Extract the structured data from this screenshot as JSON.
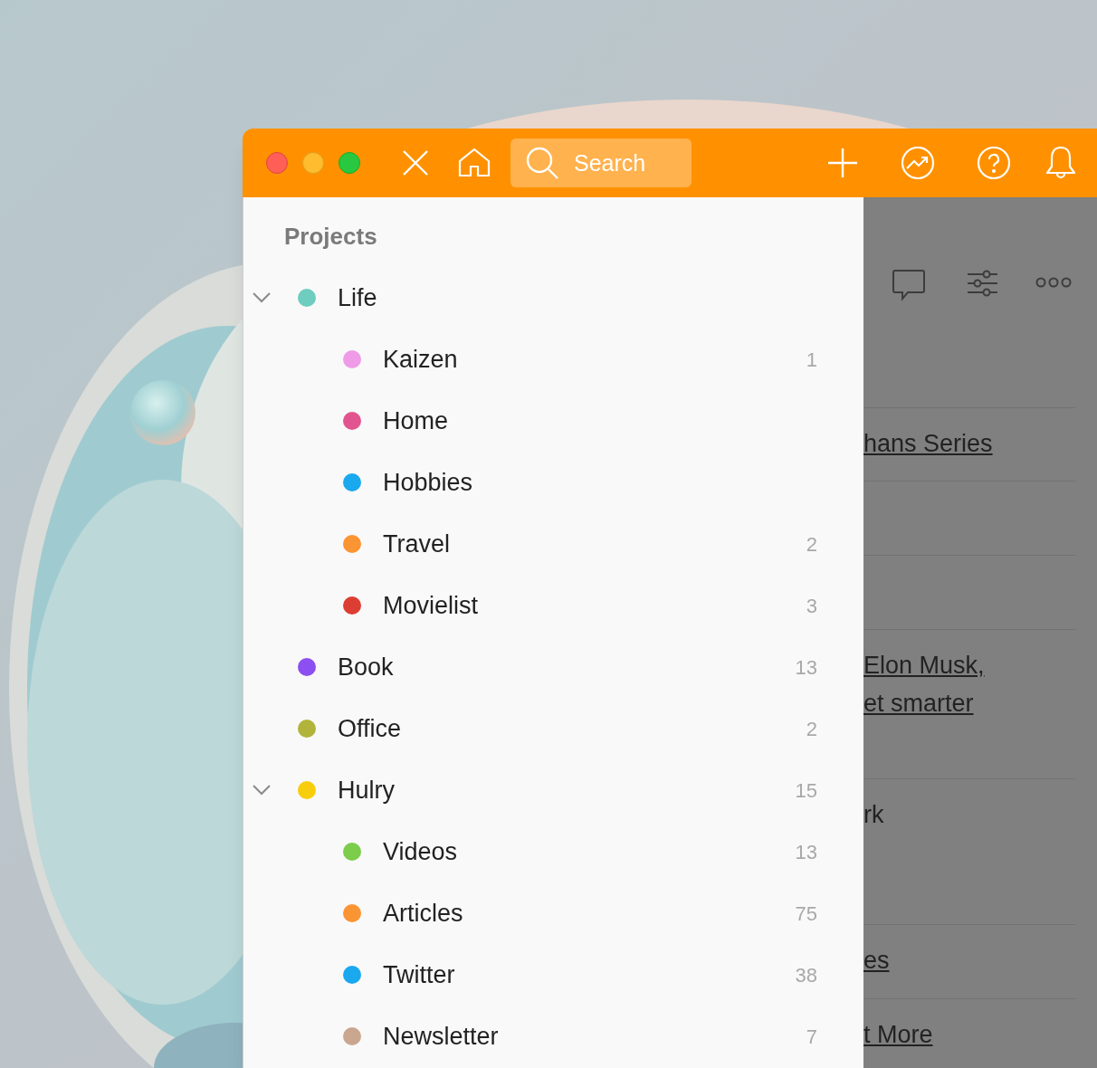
{
  "window": {
    "titlebar": {
      "search": {
        "placeholder": "Search"
      }
    }
  },
  "sidebar": {
    "heading": "Projects",
    "projects": [
      {
        "name": "Life",
        "color": "#6dcdbf",
        "expanded": true,
        "children": [
          {
            "name": "Kaizen",
            "color": "#ef9be8",
            "count": "1"
          },
          {
            "name": "Home",
            "color": "#e2548f"
          },
          {
            "name": "Hobbies",
            "color": "#1aa8ef"
          },
          {
            "name": "Travel",
            "color": "#fb9433",
            "count": "2"
          },
          {
            "name": "Movielist",
            "color": "#dd3e33",
            "count": "3"
          }
        ]
      },
      {
        "name": "Book",
        "color": "#8c4ff1",
        "count": "13"
      },
      {
        "name": "Office",
        "color": "#b1b33b",
        "count": "2"
      },
      {
        "name": "Hulry",
        "color": "#f8cd0b",
        "count": "15",
        "expanded": true,
        "children": [
          {
            "name": "Videos",
            "color": "#7ccd4a",
            "count": "13"
          },
          {
            "name": "Articles",
            "color": "#fb9433",
            "count": "75"
          },
          {
            "name": "Twitter",
            "color": "#1aa8ef",
            "count": "38"
          },
          {
            "name": "Newsletter",
            "color": "#c9a68e",
            "count": "7"
          }
        ]
      }
    ]
  },
  "detail": {
    "rows": [
      {
        "kind": "text",
        "lines": [
          "hans Series"
        ],
        "link": true
      },
      {
        "kind": "blank"
      },
      {
        "kind": "blank"
      },
      {
        "kind": "text",
        "lines": [
          "Elon Musk,",
          "et smarter"
        ],
        "link": true
      },
      {
        "kind": "text",
        "lines": [
          "rk"
        ],
        "link": false
      },
      {
        "kind": "text",
        "lines": [
          "es"
        ],
        "link": true
      },
      {
        "kind": "text",
        "lines": [
          "t More"
        ],
        "link": true
      }
    ]
  }
}
